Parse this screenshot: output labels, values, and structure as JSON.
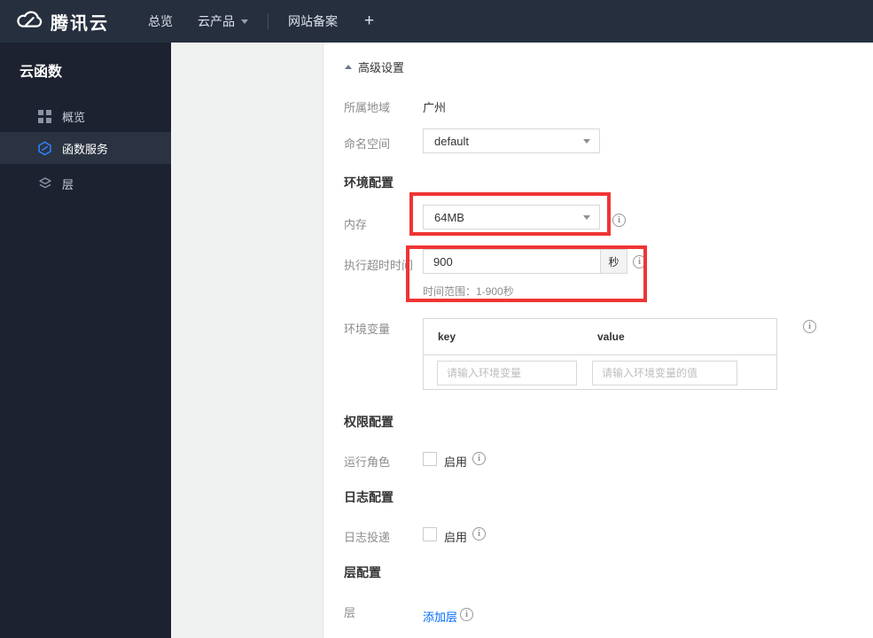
{
  "topbar": {
    "brand": "腾讯云",
    "nav": [
      {
        "label": "总览"
      },
      {
        "label": "云产品"
      },
      {
        "label": "网站备案"
      }
    ],
    "plus_label": "+"
  },
  "sidebar": {
    "title": "云函数",
    "items": [
      {
        "label": "概览",
        "icon": "overview-grid-icon",
        "selected": false
      },
      {
        "label": "函数服务",
        "icon": "scf-hexagon-icon",
        "selected": true
      },
      {
        "label": "层",
        "icon": "layers-icon",
        "selected": false
      }
    ]
  },
  "content": {
    "advanced_toggle": "高级设置",
    "region": {
      "label": "所属地域",
      "value": "广州"
    },
    "namespace": {
      "label": "命名空间",
      "value": "default"
    },
    "env_section": "环境配置",
    "memory": {
      "label": "内存",
      "value": "64MB"
    },
    "timeout": {
      "label": "执行超时时间",
      "value": "900",
      "unit": "秒",
      "hint": "时间范围：1-900秒"
    },
    "env_vars": {
      "label": "环境变量",
      "key_header": "key",
      "value_header": "value",
      "key_placeholder": "请输入环境变量",
      "value_placeholder": "请输入环境变量的值"
    },
    "perm_section": "权限配置",
    "run_role": {
      "label": "运行角色",
      "checkbox_label": "启用"
    },
    "log_section": "日志配置",
    "log_delivery": {
      "label": "日志投递",
      "checkbox_label": "启用"
    },
    "layer_section": "层配置",
    "layer": {
      "label": "层",
      "add_link": "添加层"
    }
  },
  "colors": {
    "topbar_bg": "#262f3e",
    "sidebar_bg": "#1d2230",
    "sidebar_selected_bg": "#2b3342",
    "panel_gray": "#f0f1f1",
    "accent_blue": "#0069ff",
    "annotation_red": "#ef3434",
    "border_gray": "#d8d8d8"
  }
}
